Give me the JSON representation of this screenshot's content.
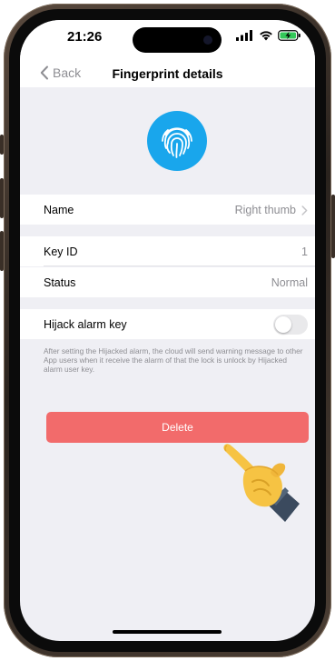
{
  "status_bar": {
    "time": "21:26",
    "icons": [
      "signal-icon",
      "wifi-icon",
      "battery-charging-icon"
    ]
  },
  "nav": {
    "back_label": "Back",
    "title": "Fingerprint details"
  },
  "fingerprint": {
    "icon": "fingerprint-icon",
    "color": "#19a6ec"
  },
  "rows": {
    "name": {
      "label": "Name",
      "value": "Right thumb"
    },
    "key_id": {
      "label": "Key ID",
      "value": "1"
    },
    "status": {
      "label": "Status",
      "value": "Normal"
    },
    "hijack": {
      "label": "Hijack alarm key",
      "enabled": false
    }
  },
  "note": "After setting the Hijacked alarm, the cloud will send warning message to other App users when it receive the alarm of that the lock is unlock by Hijacked alarm user key.",
  "delete_button": {
    "label": "Delete",
    "color": "#f26b6b"
  },
  "overlay": {
    "icon": "pointing-hand-icon"
  }
}
